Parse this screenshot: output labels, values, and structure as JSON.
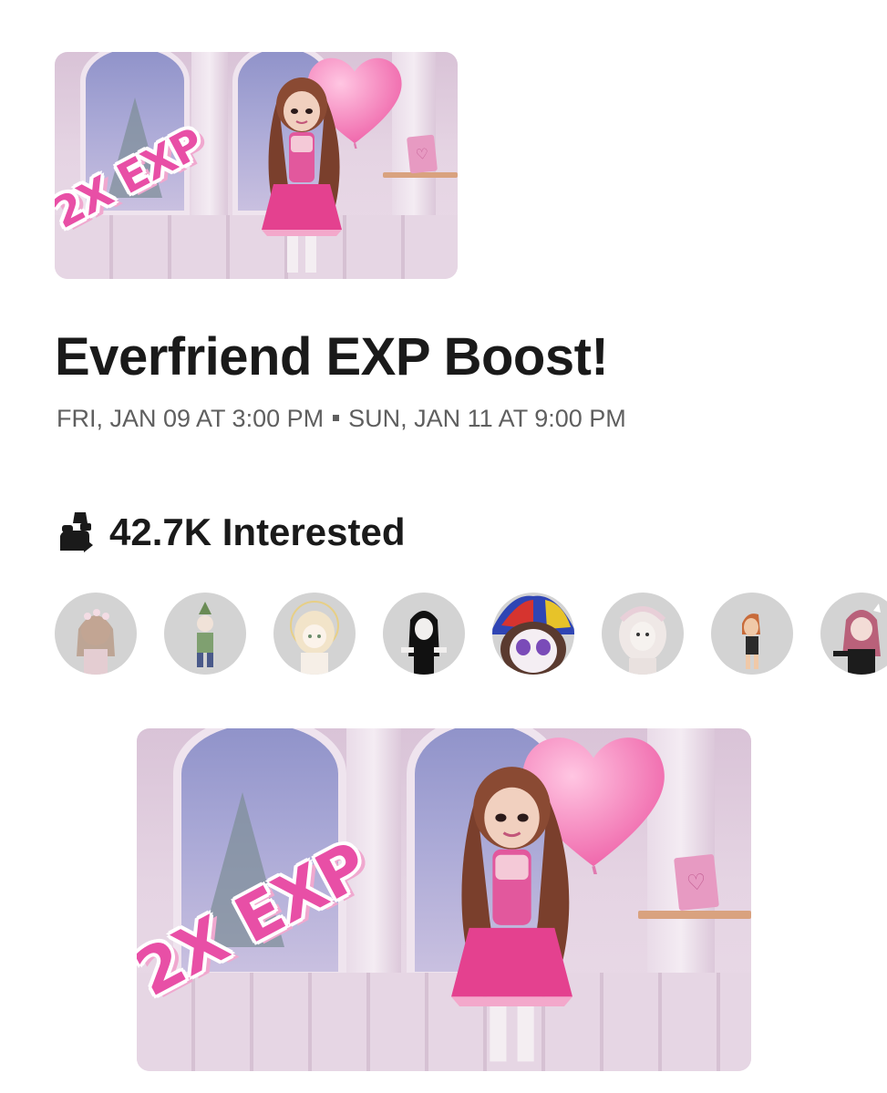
{
  "event": {
    "title": "Everfriend EXP Boost!",
    "start": "FRI, JAN 09 AT 3:00 PM",
    "end": "SUN, JAN 11 AT 9:00 PM",
    "banner_text": "2X EXP"
  },
  "interest": {
    "icon": "users-icon",
    "count_label": "42.7K Interested"
  },
  "attendees": {
    "avatar_count_visible": 8
  },
  "colors": {
    "title": "#1a1a1a",
    "meta": "#5f5f5f",
    "avatar_bg": "#d3d3d3",
    "banner_pink": "#e84fa6"
  }
}
